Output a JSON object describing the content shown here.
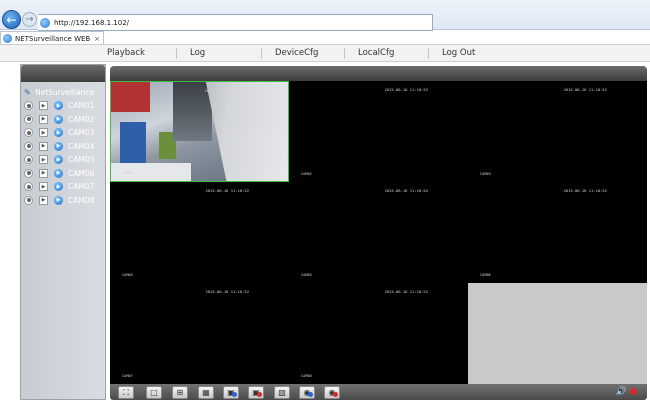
{
  "browser": {
    "url": "http://192.168.1.102/",
    "tab_title": "NETSurveillance WEB",
    "tab_close": "×",
    "back_glyph": "←",
    "forward_glyph": "→"
  },
  "menu": {
    "items": [
      "Playback",
      "Log",
      "DeviceCfg",
      "LocalCfg",
      "Log Out"
    ]
  },
  "sidebar": {
    "root_label": "NetSurveillance",
    "cameras": [
      "CAM01",
      "CAM02",
      "CAM03",
      "CAM04",
      "CAM05",
      "CAM06",
      "CAM07",
      "CAM08"
    ]
  },
  "tiles": [
    {
      "time": "2015-06-16 11:10:52",
      "cam": "CAM01",
      "state": "active"
    },
    {
      "time": "2015-06-16 11:10:52",
      "cam": "CAM02",
      "state": "black"
    },
    {
      "time": "2015-06-16 11:10:52",
      "cam": "CAM03",
      "state": "black"
    },
    {
      "time": "2015-06-16 11:10:52",
      "cam": "CAM04",
      "state": "black"
    },
    {
      "time": "2015-06-16 11:10:52",
      "cam": "CAM05",
      "state": "black"
    },
    {
      "time": "2015-06-16 11:10:52",
      "cam": "CAM06",
      "state": "black"
    },
    {
      "time": "2015-06-16 11:10:52",
      "cam": "CAM07",
      "state": "black"
    },
    {
      "time": "2015-06-16 11:10:52",
      "cam": "CAM08",
      "state": "black"
    },
    {
      "time": "",
      "cam": "",
      "state": "empty"
    }
  ],
  "toolbar": {
    "buttons": [
      {
        "icon": "fullscreen-icon",
        "glyph": "⛶"
      },
      {
        "icon": "single-view-icon",
        "glyph": "□"
      },
      {
        "icon": "quad-view-icon",
        "glyph": "⊞"
      },
      {
        "icon": "nine-view-icon",
        "glyph": "▦"
      },
      {
        "icon": "open-all-icon",
        "glyph": "▣"
      },
      {
        "icon": "close-all-icon",
        "glyph": "▣"
      },
      {
        "icon": "snapshot-icon",
        "glyph": "▨"
      },
      {
        "icon": "record-icon",
        "glyph": "◉"
      },
      {
        "icon": "stop-record-icon",
        "glyph": "◉"
      }
    ],
    "volume_glyph": "🔊"
  },
  "colors": {
    "active_border": "#3fbf3f",
    "empty_tile": "#c9c9c9",
    "sidebar_bg": "#c7ccd3"
  }
}
